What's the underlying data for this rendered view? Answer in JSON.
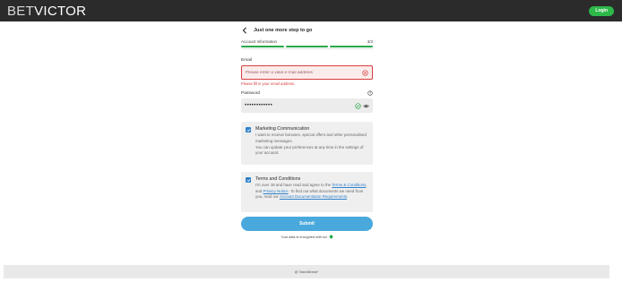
{
  "header": {
    "logo_part1": "BET",
    "logo_part2": "VICTOR",
    "login_label": "Login"
  },
  "step": {
    "title": "Just one more step to go",
    "section_label": "Account Information",
    "counter": "3/3"
  },
  "email": {
    "label": "Email",
    "placeholder": "Please enter a valid e-mail address",
    "value": "",
    "error": "Please fill in your email address."
  },
  "password": {
    "label": "Password",
    "value": "••••••••••••"
  },
  "marketing": {
    "title": "Marketing Communication",
    "body1": "I want to receive bonuses, special offers and other personalised marketing messages.",
    "body2": "You can update your preferences at any time in the settings of your account."
  },
  "terms": {
    "title": "Terms and Conditions",
    "text1": "I'm over 18 and have read and agree to the ",
    "link1": "Terms & Conditions",
    "text2": ", and ",
    "link2": "Privacy Notice",
    "text3": ". To find out what documents we need from you, read our ",
    "link3": "Account Documentation Requirements",
    "text4": "."
  },
  "submit_label": "Submit",
  "secure_note": "Your data is encrypted with ssl",
  "footer_text": "@ TakeABreak*",
  "colors": {
    "brand_dark": "#2b2b2b",
    "login_green": "#2db84a",
    "error_red": "#d83c3c",
    "submit_blue": "#4aa9dc",
    "checkbox_blue": "#2f80c9"
  }
}
